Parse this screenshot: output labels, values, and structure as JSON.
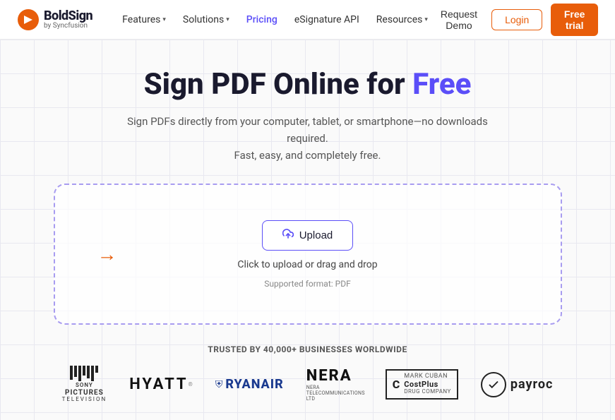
{
  "header": {
    "logo": {
      "brand": "BoldSign",
      "sub": "by Syncfusion"
    },
    "nav": [
      {
        "label": "Features",
        "hasDropdown": true
      },
      {
        "label": "Solutions",
        "hasDropdown": true
      },
      {
        "label": "Pricing",
        "hasDropdown": false
      },
      {
        "label": "eSignature API",
        "hasDropdown": false
      },
      {
        "label": "Resources",
        "hasDropdown": true
      }
    ],
    "actions": {
      "request_demo": "Request Demo",
      "login": "Login",
      "free_trial": "Free trial"
    }
  },
  "hero": {
    "title_part1": "Sign PDF Online for ",
    "title_highlight": "Free",
    "subtitle_line1": "Sign PDFs directly from your computer, tablet, or smartphone—no downloads required.",
    "subtitle_line2": "Fast, easy, and completely free."
  },
  "upload": {
    "button_label": "Upload",
    "hint": "Click to upload or drag and drop",
    "format": "Supported format: PDF"
  },
  "trusted": {
    "label": "TRUSTED BY 40,000+ BUSINESSES WORLDWIDE",
    "brands": [
      "Sony Pictures Television",
      "HYATT",
      "RYANAIR",
      "NERA",
      "CostPlus Drug Company",
      "payroc"
    ]
  }
}
